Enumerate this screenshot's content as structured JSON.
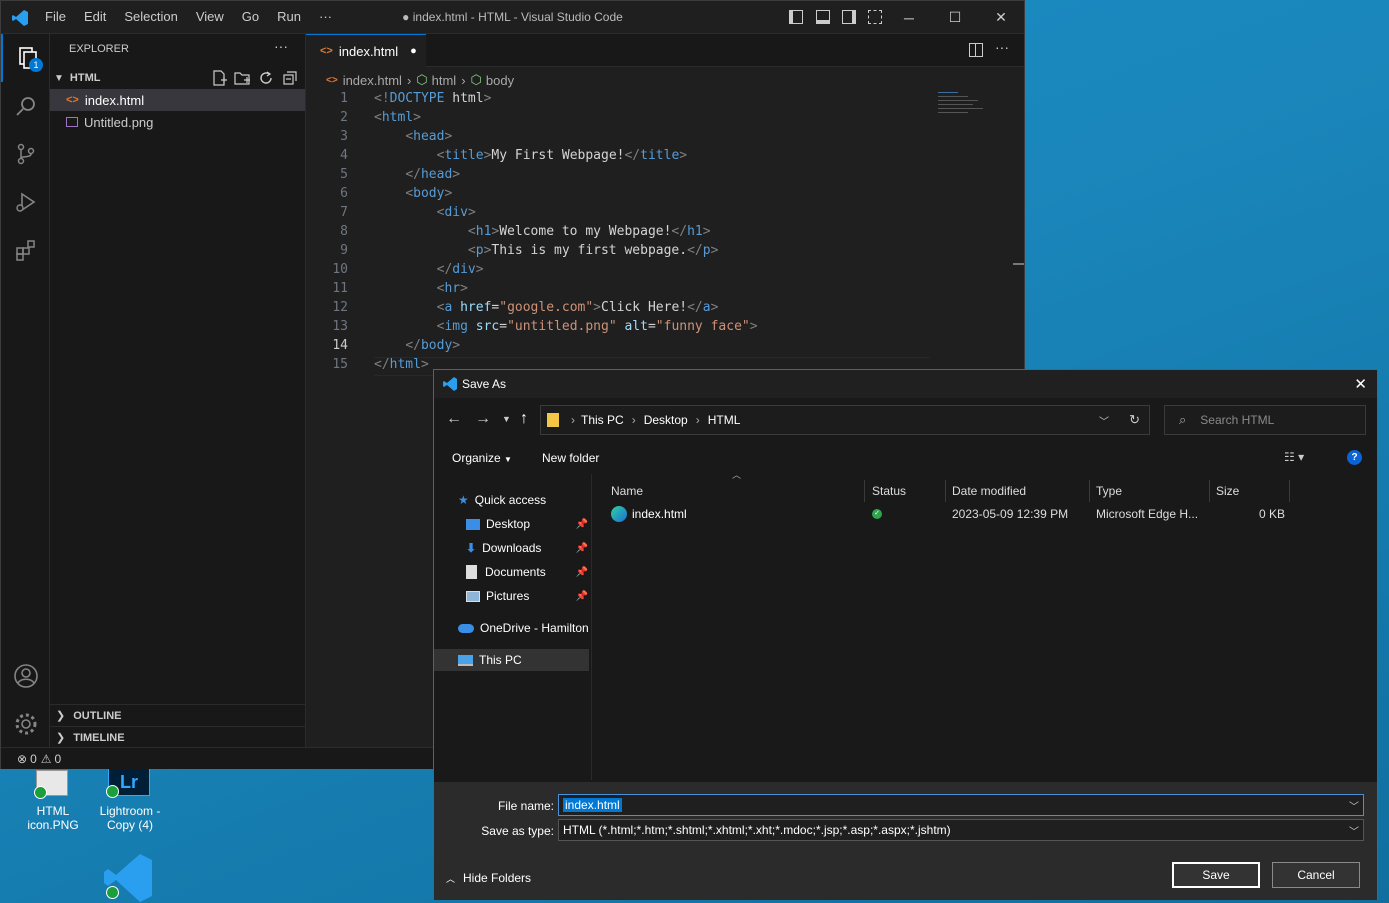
{
  "vscode": {
    "menu": [
      "File",
      "Edit",
      "Selection",
      "View",
      "Go",
      "Run",
      "···"
    ],
    "title": "● index.html - HTML - Visual Studio Code",
    "explorer_badge": "1",
    "sidebar": {
      "header": "EXPLORER",
      "folder": "HTML",
      "files": [
        "index.html",
        "Untitled.png"
      ],
      "outline": "OUTLINE",
      "timeline": "TIMELINE"
    },
    "tab": {
      "label": "index.html"
    },
    "breadcrumb": [
      "index.html",
      "html",
      "body"
    ],
    "code_lines": [
      "<!DOCTYPE html>",
      "<html>",
      "    <head>",
      "        <title>My First Webpage!</title>",
      "    </head>",
      "    <body>",
      "        <div>",
      "            <h1>Welcome to my Webpage!</h1>",
      "            <p>This is my first webpage.</p>",
      "        </div>",
      "        <hr>",
      "        <a href=\"google.com\">Click Here!</a>",
      "        <img src=\"untitled.png\" alt=\"funny face\">",
      "    </body>",
      "</html>"
    ],
    "line_numbers": [
      "1",
      "2",
      "3",
      "4",
      "5",
      "6",
      "7",
      "8",
      "9",
      "10",
      "11",
      "12",
      "13",
      "14",
      "15"
    ],
    "active_line": "14",
    "status": {
      "errors": "0",
      "warnings": "0"
    }
  },
  "dialog": {
    "title": "Save As",
    "path": [
      "This PC",
      "Desktop",
      "HTML"
    ],
    "search_placeholder": "Search HTML",
    "organize": "Organize",
    "new_folder": "New folder",
    "nav": {
      "quick_access": "Quick access",
      "items": [
        "Desktop",
        "Downloads",
        "Documents",
        "Pictures"
      ],
      "onedrive": "OneDrive - Hamilton",
      "this_pc": "This PC"
    },
    "columns": [
      "Name",
      "Status",
      "Date modified",
      "Type",
      "Size"
    ],
    "file": {
      "name": "index.html",
      "date": "2023-05-09 12:39 PM",
      "type": "Microsoft Edge H...",
      "size": "0 KB"
    },
    "file_name_label": "File name:",
    "file_name_value": "index.html",
    "save_type_label": "Save as type:",
    "save_type_value": "HTML (*.html;*.htm;*.shtml;*.xhtml;*.xht;*.mdoc;*.jsp;*.asp;*.aspx;*.jshtm)",
    "hide_folders": "Hide Folders",
    "save_label": "Save",
    "cancel_label": "Cancel"
  },
  "desktop": {
    "icons": [
      {
        "label1": "HTML",
        "label2": "icon.PNG"
      },
      {
        "label1": "Lightroom -",
        "label2": "Copy (4)"
      }
    ]
  },
  "colors": {
    "accent": "#0078d4",
    "desktop": "#1a86bb",
    "dialog_border": "#2d6da5"
  }
}
